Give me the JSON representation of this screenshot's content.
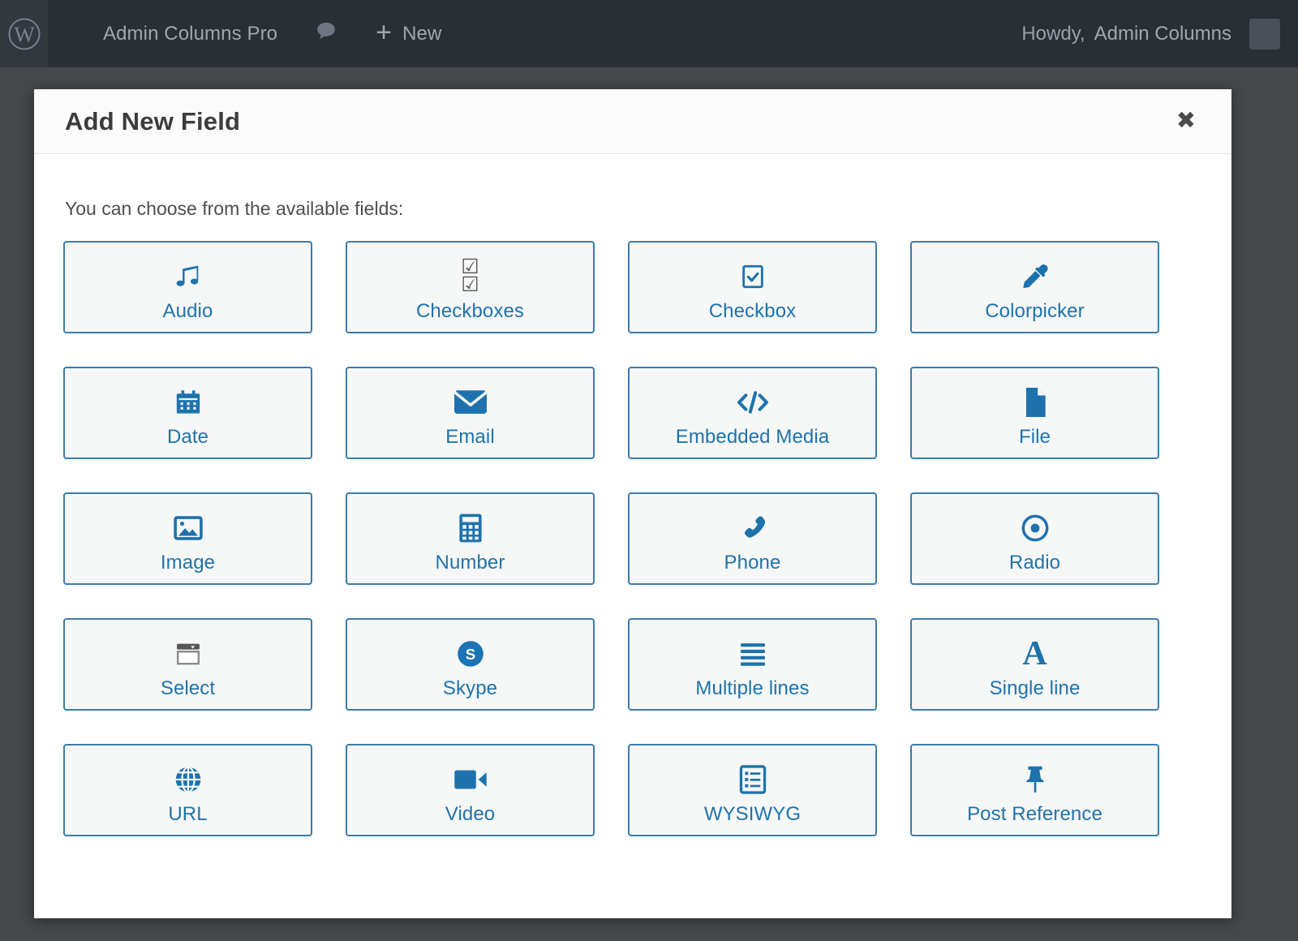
{
  "adminbar": {
    "logo_icon": "wordpress-logo-icon",
    "site_name": "Admin Columns Pro",
    "comments_icon": "comment-bubble-icon",
    "new_label": "New",
    "new_icon": "plus-icon",
    "howdy_prefix": "Howdy,",
    "user_name": "Admin Columns",
    "avatar": "avatar"
  },
  "modal": {
    "title": "Add New Field",
    "close_icon": "close-icon",
    "close_label": "✖",
    "intro": "You can choose from the available fields:"
  },
  "fields": [
    {
      "label": "Audio",
      "icon": "music-note-icon"
    },
    {
      "label": "Checkboxes",
      "icon": "checkboxes-icon"
    },
    {
      "label": "Checkbox",
      "icon": "checkbox-icon"
    },
    {
      "label": "Colorpicker",
      "icon": "eyedropper-icon"
    },
    {
      "label": "Date",
      "icon": "calendar-icon"
    },
    {
      "label": "Email",
      "icon": "envelope-icon"
    },
    {
      "label": "Embedded Media",
      "icon": "code-brackets-icon"
    },
    {
      "label": "File",
      "icon": "document-icon"
    },
    {
      "label": "Image",
      "icon": "picture-icon"
    },
    {
      "label": "Number",
      "icon": "calculator-icon"
    },
    {
      "label": "Phone",
      "icon": "phone-handset-icon"
    },
    {
      "label": "Radio",
      "icon": "radio-button-icon"
    },
    {
      "label": "Select",
      "icon": "dropdown-select-icon"
    },
    {
      "label": "Skype",
      "icon": "skype-icon"
    },
    {
      "label": "Multiple lines",
      "icon": "lines-icon"
    },
    {
      "label": "Single line",
      "icon": "letter-a-icon"
    },
    {
      "label": "URL",
      "icon": "globe-icon"
    },
    {
      "label": "Video",
      "icon": "video-camera-icon"
    },
    {
      "label": "WYSIWYG",
      "icon": "list-box-icon"
    },
    {
      "label": "Post Reference",
      "icon": "pushpin-icon"
    }
  ],
  "colors": {
    "accent_blue": "#1e73ab",
    "card_border": "#3a7cad",
    "card_fill": "#f6f7f7",
    "adminbar_bg": "#2a2e35",
    "backdrop": "#46484b"
  }
}
